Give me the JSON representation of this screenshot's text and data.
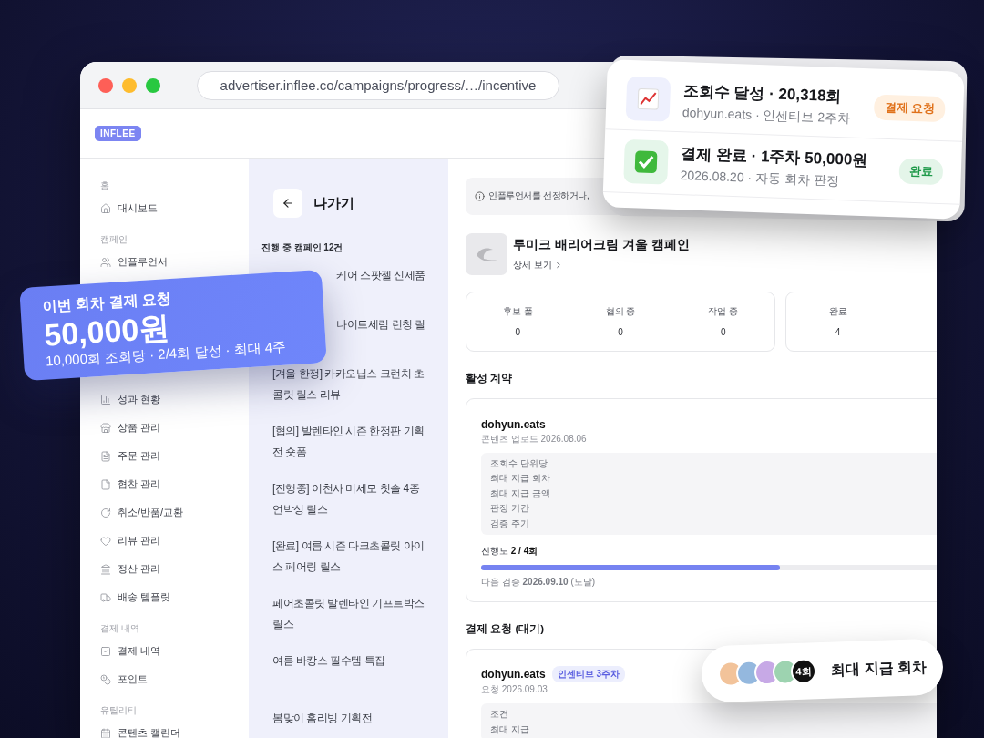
{
  "browser": {
    "url": "advertiser.inflee.co/campaigns/progress/…/incentive"
  },
  "logo": "INFLEE",
  "sidebar": {
    "sections": [
      {
        "title": "홈",
        "items": [
          {
            "label": "대시보드"
          }
        ]
      },
      {
        "title": "캠페인",
        "items": [
          {
            "label": "인플루언서"
          },
          {
            "label": "성과 현황"
          },
          {
            "label": "상품 관리"
          },
          {
            "label": "주문 관리"
          },
          {
            "label": "협찬 관리"
          },
          {
            "label": "취소/반품/교환"
          },
          {
            "label": "리뷰 관리"
          },
          {
            "label": "정산 관리"
          },
          {
            "label": "배송 템플릿"
          }
        ]
      },
      {
        "title": "결제 내역",
        "items": [
          {
            "label": "결제 내역"
          },
          {
            "label": "포인트"
          }
        ]
      },
      {
        "title": "유틸리티",
        "items": [
          {
            "label": "콘텐츠 캘린더"
          }
        ]
      }
    ]
  },
  "campaign_list": {
    "back_label": "나가기",
    "count": "진행 중 캠페인 12건",
    "covered_items": [
      "케어 스팟젤 신제품",
      "나이트세럼 런칭 릴"
    ],
    "items": [
      "[겨울 한정] 카카오닙스 크런치 초콜릿 릴스 리뷰",
      "[협의] 발렌타인 시즌 한정판 기획전 숏폼",
      "[진행중] 이천사 미세모 칫솔 4종 언박싱 릴스",
      "[완료] 여름 시즌 다크초콜릿 아이스 페어링 릴스",
      "페어초콜릿 발렌타인 기프트박스 릴스",
      "여름 바캉스 필수템 특집",
      "봄맞이 홈리빙 기획전"
    ]
  },
  "main": {
    "notice": "인플루언서를 선정하거나,",
    "campaign": {
      "name": "루미크 배리어크림 겨울 캠페인",
      "link": "상세 보기"
    },
    "stat_groups": [
      [
        {
          "label": "후보 풀",
          "value": "0"
        },
        {
          "label": "협의 중",
          "value": "0"
        },
        {
          "label": "작업 중",
          "value": "0"
        }
      ],
      [
        {
          "label": "완료",
          "value": "4"
        }
      ]
    ],
    "active_title": "활성 계약",
    "contract": {
      "handle": "dohyun.eats",
      "date": "콘텐츠 업로드 2026.08.06",
      "terms": [
        "조회수 단위당",
        "최대 지급 회차",
        "최대 지급 금액",
        "판정 기간",
        "검증 주기"
      ],
      "progress_label": "진행도 **2 / 4회**",
      "level": 0.5,
      "next_check": "다음 검증 **2026.09.10** (도달)"
    },
    "request_title": "결제 요청 (대기)",
    "request": {
      "handle": "dohyun.eats",
      "badge": "인센티브 3주차",
      "date": "요청 2026.09.03",
      "terms": [
        "조건",
        "최대 지급"
      ]
    }
  },
  "payment_card": {
    "title": "이번 회차 결제 요청",
    "amount": "50,000원",
    "detail": "10,000회 조회당 · 2/4회 달성 · 최대 4주"
  },
  "notifications": [
    {
      "kind": "views",
      "title": "조회수 달성 · 20,318회",
      "subtitle": "dohyun.eats · 인센티브 2주차",
      "badge": "결제 요청"
    },
    {
      "kind": "paid",
      "title": "결제 완료 · 1주차 50,000원",
      "subtitle": "2026.08.20 · 자동 회차 판정",
      "badge": "완료"
    }
  ],
  "rounds_pill": {
    "avatars": [
      {
        "color": "#f2c39a"
      },
      {
        "color": "#94b8de"
      },
      {
        "color": "#c7a9e6"
      },
      {
        "color": "#9dd3b0"
      }
    ],
    "count": "4회",
    "label": "최대 지급 회차"
  }
}
